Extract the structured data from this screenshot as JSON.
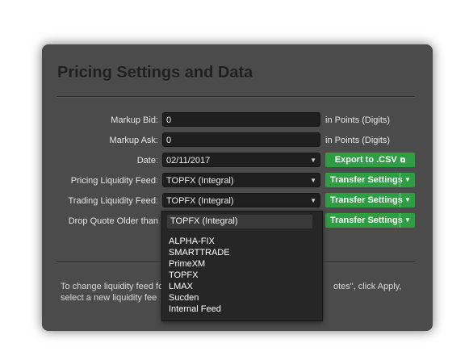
{
  "panel": {
    "title": "Pricing Settings and Data"
  },
  "form": {
    "markup_bid": {
      "label": "Markup Bid:",
      "value": "0",
      "unit": "in Points (Digits)"
    },
    "markup_ask": {
      "label": "Markup Ask:",
      "value": "0",
      "unit": "in Points (Digits)"
    },
    "date": {
      "label": "Date:",
      "value": "02/11/2017"
    },
    "pricing_feed": {
      "label": "Pricing Liquidity Feed:",
      "value": "TOPFX (Integral)"
    },
    "trading_feed": {
      "label": "Trading Liquidity Feed:",
      "value": "TOPFX (Integral)"
    },
    "drop_quote": {
      "label": "Drop Quote Older than"
    }
  },
  "buttons": {
    "export_label": "Export to .CSV",
    "transfer_label": "Transfer Settings"
  },
  "dropdown": {
    "search_value": "TOPFX (Integral)",
    "options": [
      "ALPHA-FIX",
      "SMARTTRADE",
      "PrimeXM",
      "TOPFX",
      "LMAX",
      "Sucden",
      "Internal Feed"
    ]
  },
  "info": {
    "line1_left": "To change liquidity feed fo",
    "line1_right": "otes\", click Apply,",
    "line2_left": "select a new liquidity fee"
  },
  "icons": {
    "caret": "caret-down-icon",
    "external": "external-link-icon"
  }
}
